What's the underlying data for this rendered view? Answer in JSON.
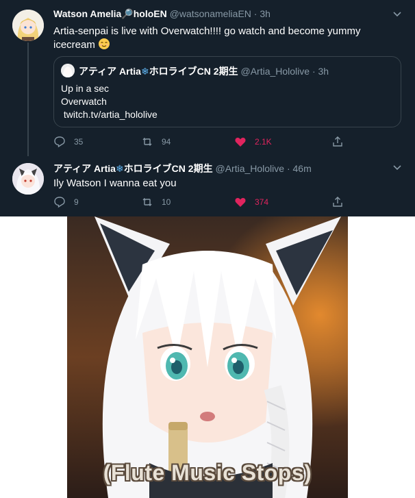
{
  "tweet1": {
    "name": "Watson Amelia🔎holoEN",
    "handle": "@watsonameliaEN",
    "time": "· 3h",
    "text_line1": "Artia-senpai is live with Overwatch!!!! go watch and become yummy",
    "text_line2": "icecream",
    "emoji": "relieved-face",
    "quote": {
      "name_pre": "アティア Artia",
      "name_post": "ホロライブCN 2期生",
      "handle": "@Artia_Hololive",
      "time": "· 3h",
      "line1": "Up in a sec",
      "line2": "Overwatch",
      "line3": " twitch.tv/artia_hololive"
    },
    "replies": "35",
    "retweets": "94",
    "likes": "2.1K"
  },
  "tweet2": {
    "name_pre": "アティア Artia",
    "name_post": "ホロライブCN 2期生",
    "handle": "@Artia_Hololive",
    "time": "· 46m",
    "text": "Ily Watson I wanna eat you",
    "replies": "9",
    "retweets": "10",
    "likes": "374"
  },
  "meme": {
    "caption": "(Flute Music Stops)"
  },
  "colors": {
    "background": "#15202b",
    "border": "#38444d",
    "secondary_text": "#8899a6",
    "like": "#e0245e"
  }
}
